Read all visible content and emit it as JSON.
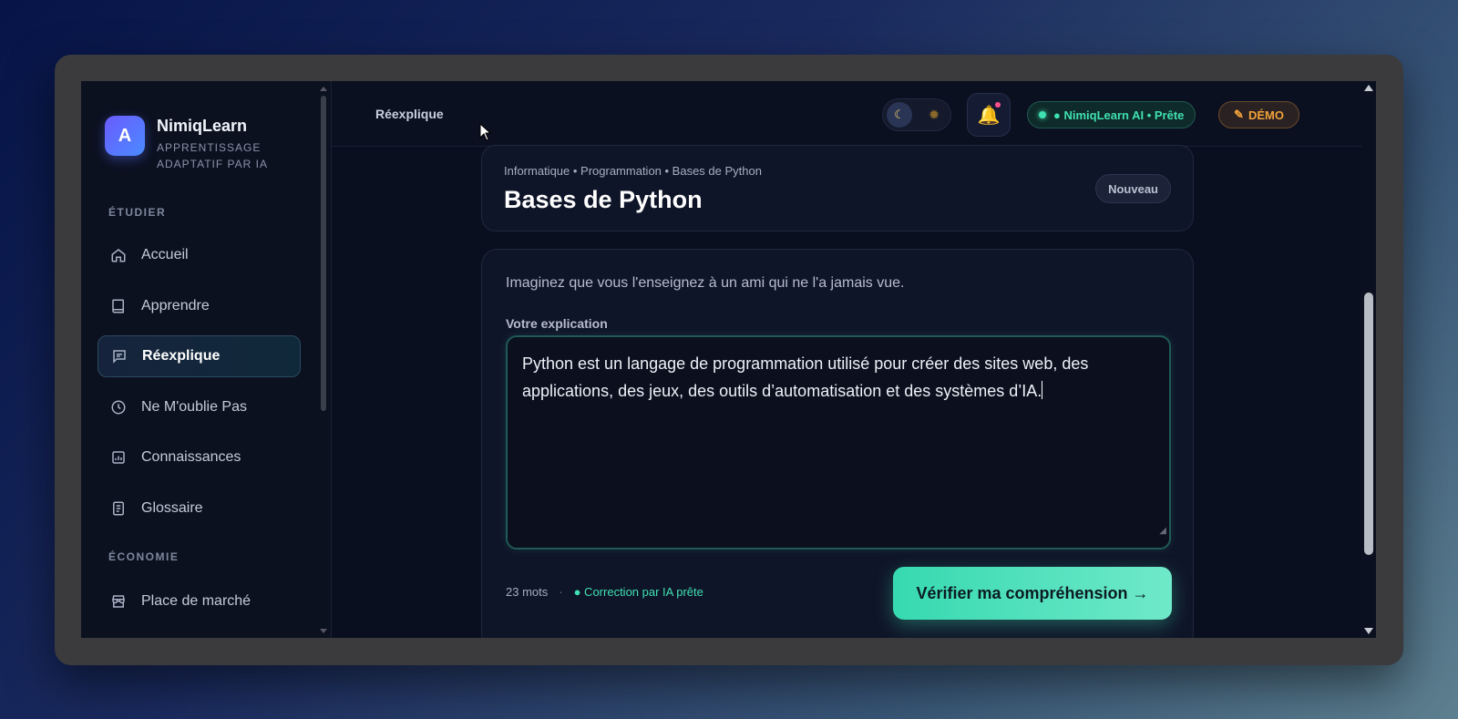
{
  "app": {
    "name": "NimiqLearn",
    "tagline": "APPRENTISSAGE ADAPTATIF PAR IA",
    "logo_letter": "A"
  },
  "sidebar": {
    "sections": [
      {
        "label": "ÉTUDIER"
      },
      {
        "label": "ÉCONOMIE"
      }
    ],
    "items": [
      {
        "label": "Accueil",
        "icon": "home-icon"
      },
      {
        "label": "Apprendre",
        "icon": "book-icon"
      },
      {
        "label": "Réexplique",
        "icon": "chat-icon",
        "active": true
      },
      {
        "label": "Ne M'oublie Pas",
        "icon": "clock-icon"
      },
      {
        "label": "Connaissances",
        "icon": "chart-icon"
      },
      {
        "label": "Glossaire",
        "icon": "document-icon"
      },
      {
        "label": "Place de marché",
        "icon": "store-icon"
      }
    ]
  },
  "topbar": {
    "page_label": "Réexplique",
    "status": "● NimiqLearn AI • Prête",
    "demo": "DÉMO",
    "accent_teal": "#3fe0b2",
    "accent_orange": "#f0a13a"
  },
  "header_card": {
    "breadcrumb": "Informatique • Programmation • Bases de Python",
    "title": "Bases de Python",
    "badge": "Nouveau"
  },
  "exercise": {
    "prompt": "Imaginez que vous l'enseignez à un ami qui ne l'a jamais vue.",
    "field_label": "Votre explication",
    "text": "Python est un langage de programmation utilisé pour créer des sites web, des applications, des jeux, des outils d’automatisation et des systèmes d’IA.",
    "word_count": "23 mots",
    "separator": "·",
    "ai_status": "● Correction par IA prête",
    "submit": "Vérifier ma compréhension →"
  }
}
